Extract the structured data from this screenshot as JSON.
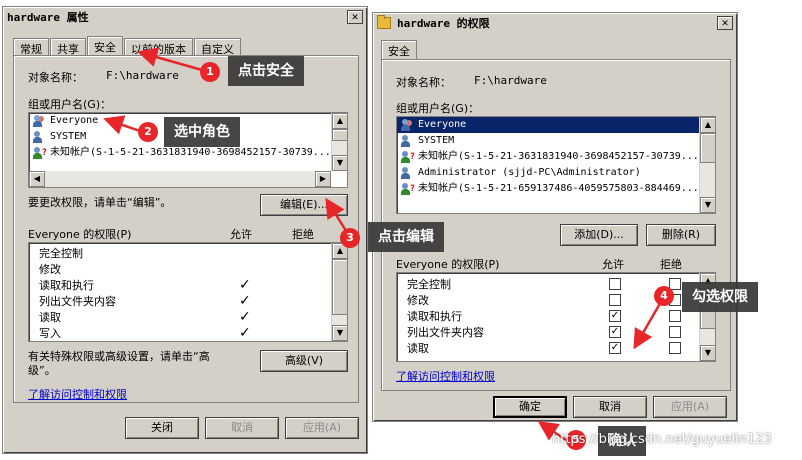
{
  "colors": {
    "accent": "#0a246a",
    "annotation_red": "#e8262a",
    "window_bg": "#d4d0c8",
    "link": "#0000cc"
  },
  "left_window": {
    "title": "hardware 属性",
    "tabs": [
      "常规",
      "共享",
      "安全",
      "以前的版本",
      "自定义"
    ],
    "active_tab": "安全",
    "object_label": "对象名称：",
    "object_value": "F:\\hardware",
    "group_label": "组或用户名(G)：",
    "users": [
      {
        "name": "Everyone",
        "icon": "group-icon"
      },
      {
        "name": "SYSTEM",
        "icon": "user-icon"
      },
      {
        "name": "未知帐户(S-1-5-21-3631831940-3698452157-30739...",
        "icon": "unknown-user-icon"
      }
    ],
    "change_hint": "要更改权限，请单击“编辑”。",
    "edit_button": "编辑(E)...",
    "perm_header": "Everyone 的权限(P)",
    "allow_label": "允许",
    "deny_label": "拒绝",
    "permissions": [
      {
        "name": "完全控制",
        "allow": false
      },
      {
        "name": "修改",
        "allow": false
      },
      {
        "name": "读取和执行",
        "allow": true
      },
      {
        "name": "列出文件夹内容",
        "allow": true
      },
      {
        "name": "读取",
        "allow": true
      },
      {
        "name": "写入",
        "allow": true
      }
    ],
    "special_hint_line1": "有关特殊权限或高级设置，请单击“高",
    "special_hint_line2": "级”。",
    "advanced_button": "高级(V)",
    "learn_link": "了解访问控制和权限",
    "close_button": "关闭",
    "cancel_button": "取消",
    "apply_button": "应用(A)"
  },
  "right_window": {
    "title": "hardware 的权限",
    "tab": "安全",
    "object_label": "对象名称：",
    "object_value": "F:\\hardware",
    "group_label": "组或用户名(G)：",
    "users": [
      {
        "name": "Everyone",
        "icon": "group-icon",
        "selected": true
      },
      {
        "name": "SYSTEM",
        "icon": "user-icon"
      },
      {
        "name": "未知帐户(S-1-5-21-3631831940-3698452157-30739...",
        "icon": "unknown-user-icon"
      },
      {
        "name": "Administrator (sjjd-PC\\Administrator)",
        "icon": "user-icon"
      },
      {
        "name": "未知帐户(S-1-5-21-659137486-4059575803-884469...",
        "icon": "unknown-user-icon"
      }
    ],
    "add_button": "添加(D)...",
    "remove_button": "删除(R)",
    "perm_header": "Everyone 的权限(P)",
    "allow_label": "允许",
    "deny_label": "拒绝",
    "permissions": [
      {
        "name": "完全控制",
        "allow": false,
        "deny": false
      },
      {
        "name": "修改",
        "allow": false,
        "deny": false
      },
      {
        "name": "读取和执行",
        "allow": true,
        "deny": false
      },
      {
        "name": "列出文件夹内容",
        "allow": true,
        "deny": false
      },
      {
        "name": "读取",
        "allow": true,
        "deny": false
      }
    ],
    "learn_link": "了解访问控制和权限",
    "ok_button": "确定",
    "cancel_button": "取消",
    "apply_button": "应用(A)"
  },
  "annotations": [
    {
      "num": "1",
      "text": "点击安全"
    },
    {
      "num": "2",
      "text": "选中角色"
    },
    {
      "num": "3",
      "text": "点击编辑"
    },
    {
      "num": "4",
      "text": "勾选权限"
    },
    {
      "num": "5",
      "text": "确认"
    }
  ],
  "watermark": "https://blog.csdn.net/guyuelin123",
  "close_glyph": "✕",
  "check_glyph": "✓"
}
